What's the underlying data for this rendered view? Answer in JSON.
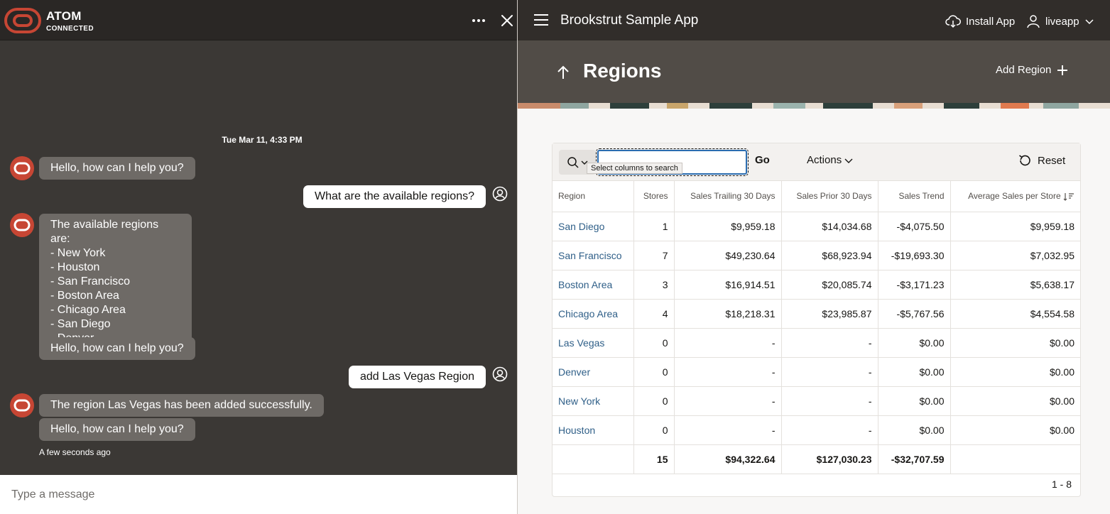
{
  "chat": {
    "title": "ATOM",
    "status": "CONNECTED",
    "date_divider": "Tue Mar 11, 4:33 PM",
    "messages": [
      {
        "from": "bot",
        "text": "Hello, how can I help you?"
      },
      {
        "from": "user",
        "text": "What are the available regions?"
      },
      {
        "from": "bot",
        "text": "The available regions are:\n- New York\n- Houston\n- San Francisco\n- Boston Area\n- Chicago Area\n- San Diego\n- Denver"
      },
      {
        "from": "bot",
        "text": "Hello, how can I help you?"
      },
      {
        "from": "user",
        "text": "add Las Vegas Region"
      },
      {
        "from": "bot",
        "text": "The region Las Vegas has been added successfully."
      },
      {
        "from": "bot",
        "text": "Hello, how can I help you?"
      }
    ],
    "last_timestamp": "A few seconds ago",
    "input_placeholder": "Type a message",
    "icons": {
      "logo": "atom-logo-icon",
      "more": "more-horizontal-icon",
      "close": "close-icon",
      "bot": "bot-avatar-icon",
      "user": "user-avatar-icon"
    },
    "colors": {
      "header_bg": "#2a2725",
      "panel_bg": "#3b3835",
      "bot_bubble": "#6e6a66",
      "user_bubble": "#ffffff",
      "brand_red": "#c74634"
    }
  },
  "app": {
    "title": "Brookstrut Sample App",
    "install_label": "Install App",
    "user_label": "liveapp",
    "page_title": "Regions",
    "add_region_label": "Add Region",
    "search": {
      "value": "",
      "placeholder": "",
      "tooltip": "Select columns to search"
    },
    "go_label": "Go",
    "actions_label": "Actions",
    "reset_label": "Reset",
    "table": {
      "columns": [
        "Region",
        "Stores",
        "Sales Trailing 30 Days",
        "Sales Prior 30 Days",
        "Sales Trend",
        "Average Sales per Store"
      ],
      "rows": [
        [
          "San Diego",
          "1",
          "$9,959.18",
          "$14,034.68",
          "-$4,075.50",
          "$9,959.18"
        ],
        [
          "San Francisco",
          "7",
          "$49,230.64",
          "$68,923.94",
          "-$19,693.30",
          "$7,032.95"
        ],
        [
          "Boston Area",
          "3",
          "$16,914.51",
          "$20,085.74",
          "-$3,171.23",
          "$5,638.17"
        ],
        [
          "Chicago Area",
          "4",
          "$18,218.31",
          "$23,985.87",
          "-$5,767.56",
          "$4,554.58"
        ],
        [
          "Las Vegas",
          "0",
          "-",
          "-",
          "$0.00",
          "$0.00"
        ],
        [
          "Denver",
          "0",
          "-",
          "-",
          "$0.00",
          "$0.00"
        ],
        [
          "New York",
          "0",
          "-",
          "-",
          "$0.00",
          "$0.00"
        ],
        [
          "Houston",
          "0",
          "-",
          "-",
          "$0.00",
          "$0.00"
        ]
      ],
      "totals": [
        "",
        "15",
        "$94,322.64",
        "$127,030.23",
        "-$32,707.59",
        ""
      ],
      "sort_column": "Average Sales per Store",
      "sort_direction": "descending"
    },
    "pagination": "1 - 8",
    "icons": {
      "menu": "hamburger-menu-icon",
      "install": "cloud-download-icon",
      "user": "user-icon",
      "chevron": "chevron-down-icon",
      "back": "arrow-up-icon",
      "add": "plus-icon",
      "search": "search-icon",
      "reset": "reset-icon",
      "sort": "sort-descending-icon"
    },
    "colors": {
      "header_bg": "#312d2a",
      "hero_bg": "#514c47",
      "link": "#2f5f88",
      "focus": "#2a6cb0"
    }
  }
}
